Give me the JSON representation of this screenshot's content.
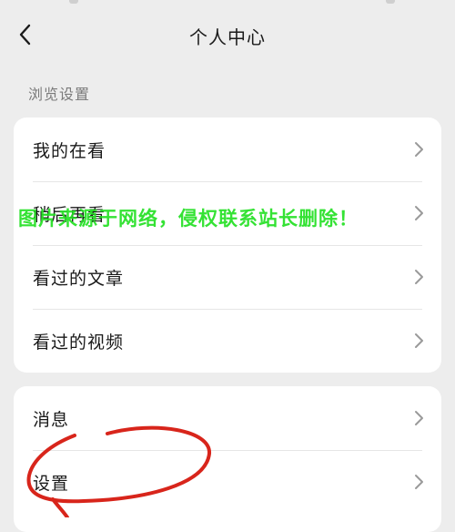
{
  "header": {
    "title": "个人中心",
    "back_icon": "chevron-left-icon"
  },
  "browse_section": {
    "label": "浏览设置",
    "items": [
      {
        "label": "我的在看"
      },
      {
        "label": "稍后再看"
      },
      {
        "label": "看过的文章"
      },
      {
        "label": "看过的视频"
      }
    ]
  },
  "other_section": {
    "items": [
      {
        "label": "消息"
      },
      {
        "label": "设置"
      }
    ]
  },
  "overlay": {
    "watermark_text": "图片来源于网络，侵权联系站长删除！",
    "watermark_color": "#23e023",
    "annotation_color": "#d8251b"
  },
  "colors": {
    "background": "#ededed",
    "card": "#ffffff",
    "chevron": "#9a9a9a"
  }
}
